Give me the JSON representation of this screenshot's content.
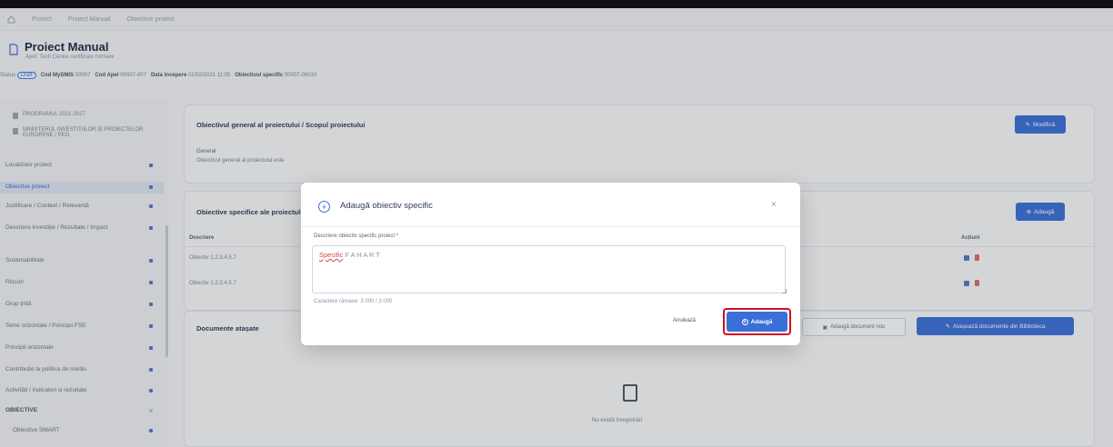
{
  "breadcrumb": {
    "items": [
      "Proiect",
      "Proiect Manual",
      "Obiective proiect"
    ]
  },
  "header": {
    "title": "Proiect Manual",
    "subtitle": "Apel: Tech Centre certificare formare",
    "meta": [
      {
        "label": "Status",
        "value": "Draft"
      },
      {
        "label": "Cod MySMIS",
        "value": "00007"
      },
      {
        "label": "Cod Apel",
        "value": "00007-007"
      },
      {
        "label": "Data începere",
        "value": "01/02/2021 11:05"
      },
      {
        "label": "Obiectivul specific",
        "value": "00007-00010"
      }
    ]
  },
  "sidebar": {
    "top_items": [
      "PROGRAMUL 2021-2027",
      "MINISTERUL INVESTIȚIILOR ȘI PROIECTELOR EUROPENE / PEO"
    ],
    "items": [
      {
        "label": "Localizare proiect",
        "active": false
      },
      {
        "label": "Obiective proiect",
        "active": true
      },
      {
        "label": "Justificare / Context / Relevanță",
        "active": false
      },
      {
        "label": "Descriere investiție / Rezultate / Impact",
        "active": false
      },
      {
        "label": "Sustenabilitate",
        "active": false
      },
      {
        "label": "Riscuri",
        "active": false
      },
      {
        "label": "Grup țintă",
        "active": false
      },
      {
        "label": "Teme orizontale / Principii FSE",
        "active": false
      },
      {
        "label": "Principii orizontale",
        "active": false
      },
      {
        "label": "Contribuție la politica de mediu",
        "active": false
      },
      {
        "label": "Activități / Indicatori și rezultate",
        "active": false
      },
      {
        "label": "OBIECTIVE",
        "active": false
      },
      {
        "label": "Obiective SMART",
        "active": false
      }
    ]
  },
  "panels": {
    "general": {
      "title": "Obiectivul general al proiectului / Scopul proiectului",
      "edit_label": "Modifică",
      "field_label": "General",
      "field_value": "Obiectivul general al proiectului este"
    },
    "specific": {
      "title": "Obiective specifice ale proiectului",
      "add_label": "Adaugă",
      "col_description": "Descriere",
      "col_actions": "Acțiuni",
      "rows": [
        "Obiectiv 1.2.3.4.5.7",
        "Obiectiv 1.2.3.4.5.7"
      ]
    },
    "documents": {
      "title": "Documente atașate",
      "add_doc_label": "Adaugă document nou",
      "attach_label": "Atașează documente din Biblioteca",
      "empty_text": "Nu există înregistrări"
    }
  },
  "modal": {
    "title": "Adaugă obiectiv specific",
    "close": "×",
    "field_label": "Descriere obiectiv specific proiect *",
    "textarea_underlined": "Specific",
    "textarea_rest": " F A H A R T",
    "char_count": "Caractere rămase: 3 000 / 3 000",
    "cancel_label": "Anulează",
    "add_label": "Adaugă"
  },
  "colors": {
    "primary": "#3b6fd8",
    "highlight": "#d10d1e"
  }
}
